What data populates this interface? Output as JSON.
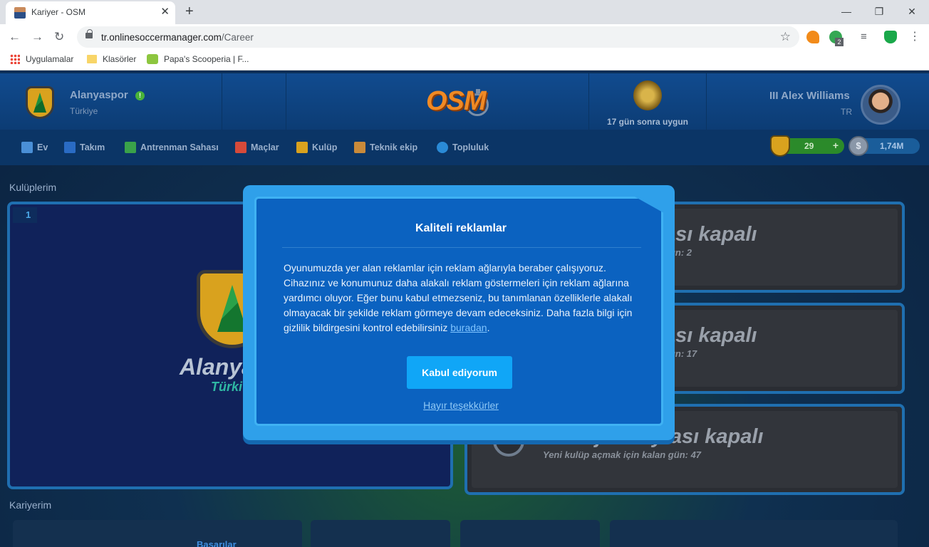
{
  "browser": {
    "tab_title": "Kariyer - OSM",
    "tab_close": "✕",
    "new_tab": "+",
    "url_domain": "tr.onlinesoccermanager.com",
    "url_path": "/Career",
    "ext_badge": "2",
    "bookmarks": [
      "Uygulamalar",
      "Klasörler",
      "Papa's Scooperia | F..."
    ]
  },
  "header": {
    "club_name": "Alanyaspor",
    "club_country": "Türkiye",
    "club_alert": "!",
    "logo": "OSM",
    "availability": "17 gün sonra uygun",
    "manager_name": "III Alex Williams",
    "manager_country": "TR"
  },
  "nav": {
    "items": [
      "Ev",
      "Takım",
      "Antrenman Sahası",
      "Maçlar",
      "Kulüp",
      "Teknik ekip",
      "Topluluk"
    ],
    "coins": "29",
    "coins_plus": "+",
    "cash": "1,74M",
    "cash_symbol": "$"
  },
  "clubs": {
    "label": "Kulüplerim",
    "slot_number": "1",
    "club_name": "Alanya",
    "club_country": "Türki",
    "locked_slots": [
      {
        "title": "ası kapalı",
        "subtitle": "gün: 2"
      },
      {
        "title": "ası kapalı",
        "subtitle": "gün: 17"
      },
      {
        "title": "Menajer Sayfası kapalı",
        "subtitle": "Yeni kulüp açmak için kalan gün: 47"
      }
    ]
  },
  "career": {
    "label": "Kariyerim",
    "tab": "Başarılar"
  },
  "modal": {
    "title": "Kaliteli reklamlar",
    "body": "Oyunumuzda yer alan reklamlar için reklam ağlarıyla beraber çalışıyoruz. Cihazınız ve konumunuz daha alakalı reklam göstermeleri için reklam ağlarına yardımcı oluyor. Eğer bunu kabul etmezseniz, bu tanımlanan özelliklerle alakalı olmayacak bir şekilde reklam görmeye devam edeceksiniz. Daha fazla bilgi için gizlilik bildirgesini kontrol edebilirsiniz ",
    "link": "buradan",
    "body_end": ".",
    "accept": "Kabul ediyorum",
    "decline": "Hayır teşekkürler"
  }
}
